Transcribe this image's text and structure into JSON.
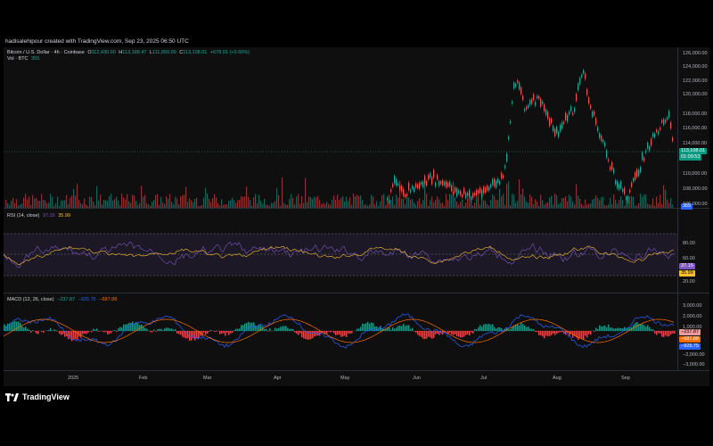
{
  "credit": "hadisalehipour created with TradingView.com, Sep 23, 2025 06:50 UTC",
  "main": {
    "symbol": "Bitcoin / U.S. Dollar · 4h · Coinbase",
    "o_label": "O",
    "o": "112,430.00",
    "h_label": "H",
    "h": "113,188.47",
    "l_label": "L",
    "l": "111,950.00",
    "c_label": "C",
    "c": "113,108.01",
    "chg": "+678.01 (+0.60%)",
    "vol_label": "Vol · BTC",
    "vol": "355",
    "price_ticks": [
      "126,000.00",
      "124,000.00",
      "122,000.00",
      "120,000.00",
      "118,000.00",
      "116,000.00",
      "114,000.00",
      "110,000.00",
      "108,000.00",
      "106,000.00"
    ],
    "last_price": "113,108.01",
    "countdown": "01:09:53",
    "vol_tag": "355"
  },
  "rsi": {
    "label": "RSI (14, close)",
    "v1": "37.15",
    "v2": "35.99",
    "ticks": [
      "80.00",
      "60.00",
      "20.00"
    ],
    "tag1": "37.15",
    "tag2": "35.99"
  },
  "macd": {
    "label": "MACD (12, 26, close)",
    "v1": "−237.87",
    "v2": "−925.75",
    "v3": "−687.88",
    "ticks": [
      "3,000.00",
      "2,000.00",
      "1,000.00",
      "−2,000.00",
      "−3,000.00"
    ],
    "tag1": "−237.87",
    "tag2": "−687.88",
    "tag3": "−925.75"
  },
  "x_ticks": [
    "2025",
    "Feb",
    "Mar",
    "Apr",
    "May",
    "Jun",
    "Jul",
    "Aug",
    "Sep"
  ],
  "brand": "TradingView",
  "colors": {
    "up": "#26a69a",
    "down": "#ef5350",
    "rsi": "#7e57c2",
    "rsi_ma": "#fbc02d",
    "macd": "#2962ff",
    "signal": "#ff6d00",
    "hist_up": "#26a69a",
    "hist_down": "#ff5252"
  }
}
